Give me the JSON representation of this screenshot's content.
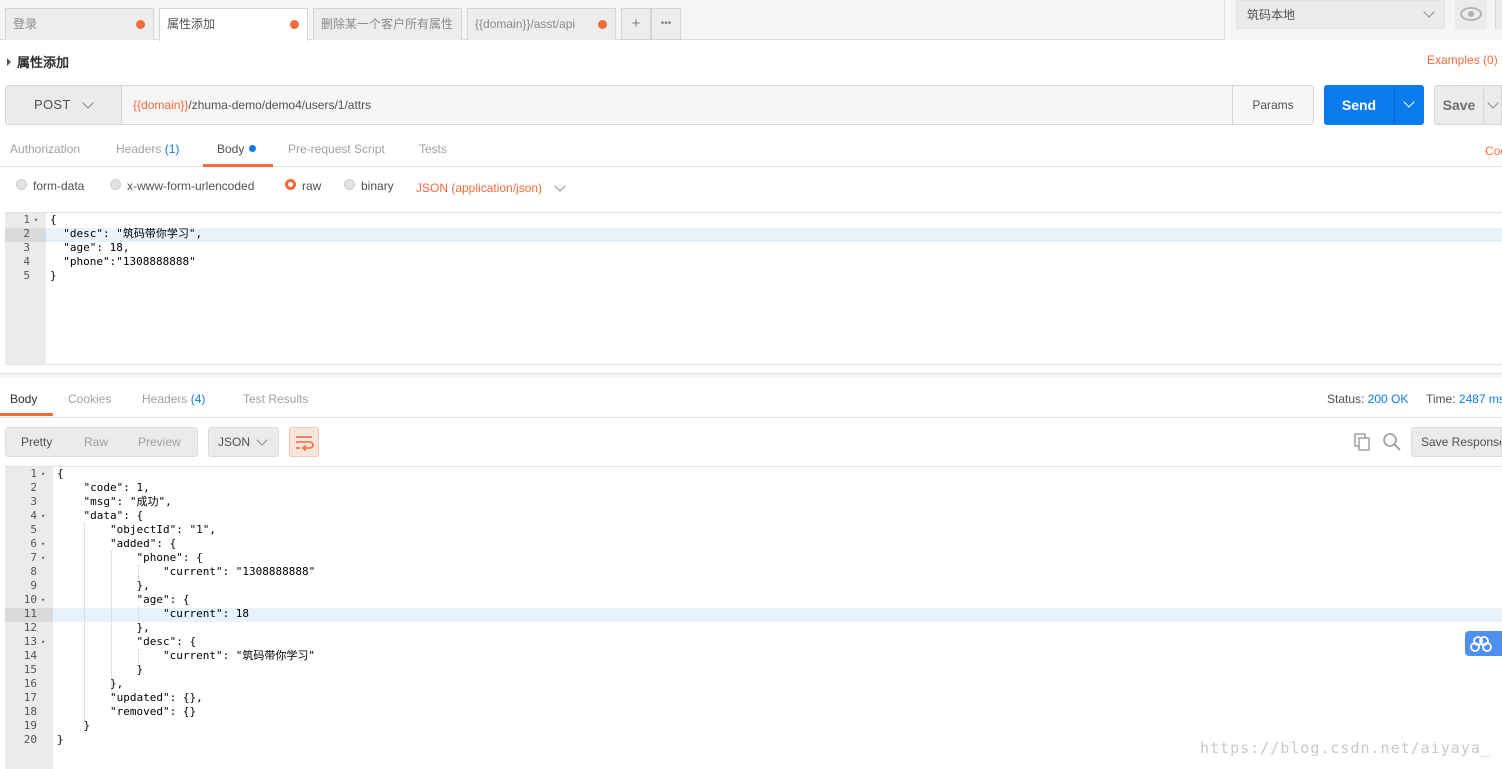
{
  "tabs": [
    {
      "label": "登录",
      "dirty": true
    },
    {
      "label": "属性添加",
      "dirty": true,
      "active": true
    },
    {
      "label": "删除某一个客户所有属性",
      "dirty": false
    },
    {
      "label": "{{domain}}/asst/api",
      "dirty": true
    }
  ],
  "tab_actions": {
    "add": "+",
    "more": "•••"
  },
  "environment": {
    "selected": "筑码本地"
  },
  "request": {
    "name": "属性添加",
    "examples": "Examples (0)",
    "method": "POST",
    "url_var": "{{domain}}",
    "url_path": "/zhuma-demo/demo4/users/1/attrs",
    "params": "Params",
    "send": "Send",
    "save": "Save"
  },
  "request_tabs": {
    "authorization": "Authorization",
    "headers": "Headers",
    "headers_count": "(1)",
    "body": "Body",
    "prerequest": "Pre-request Script",
    "tests": "Tests",
    "code": "Code"
  },
  "body_types": {
    "form_data": "form-data",
    "urlencoded": "x-www-form-urlencoded",
    "raw": "raw",
    "binary": "binary",
    "selected": "raw",
    "content_type": "JSON (application/json)"
  },
  "request_body": {
    "line_numbers": [
      "1",
      "2",
      "3",
      "4",
      "5"
    ],
    "lines": [
      "{",
      "  \"desc\": \"筑码带你学习\",",
      "  \"age\": 18,",
      "  \"phone\":\"1308888888\"",
      "}"
    ],
    "highlighted_line": 2
  },
  "response_tabs": {
    "body": "Body",
    "cookies": "Cookies",
    "headers": "Headers",
    "headers_count": "(4)",
    "test_results": "Test Results"
  },
  "response_status": {
    "status_label": "Status:",
    "status_value": "200 OK",
    "time_label": "Time:",
    "time_value": "2487 ms"
  },
  "response_view": {
    "pretty": "Pretty",
    "raw": "Raw",
    "preview": "Preview",
    "format": "JSON",
    "save_response": "Save Response"
  },
  "response_body": {
    "line_numbers": [
      "1",
      "2",
      "3",
      "4",
      "5",
      "6",
      "7",
      "8",
      "9",
      "10",
      "11",
      "12",
      "13",
      "14",
      "15",
      "16",
      "17",
      "18",
      "19",
      "20"
    ],
    "lines": [
      "{",
      "    \"code\": 1,",
      "    \"msg\": \"成功\",",
      "    \"data\": {",
      "        \"objectId\": \"1\",",
      "        \"added\": {",
      "            \"phone\": {",
      "                \"current\": \"1308888888\"",
      "            },",
      "            \"age\": {",
      "                \"current\": 18",
      "            },",
      "            \"desc\": {",
      "                \"current\": \"筑码带你学习\"",
      "            }",
      "        },",
      "        \"updated\": {},",
      "        \"removed\": {}",
      "    }",
      "}"
    ],
    "highlighted_line": 11
  },
  "watermark": "https://blog.csdn.net/aiyaya_",
  "colors": {
    "accent": "#f26b3a",
    "primary": "#097bed"
  }
}
